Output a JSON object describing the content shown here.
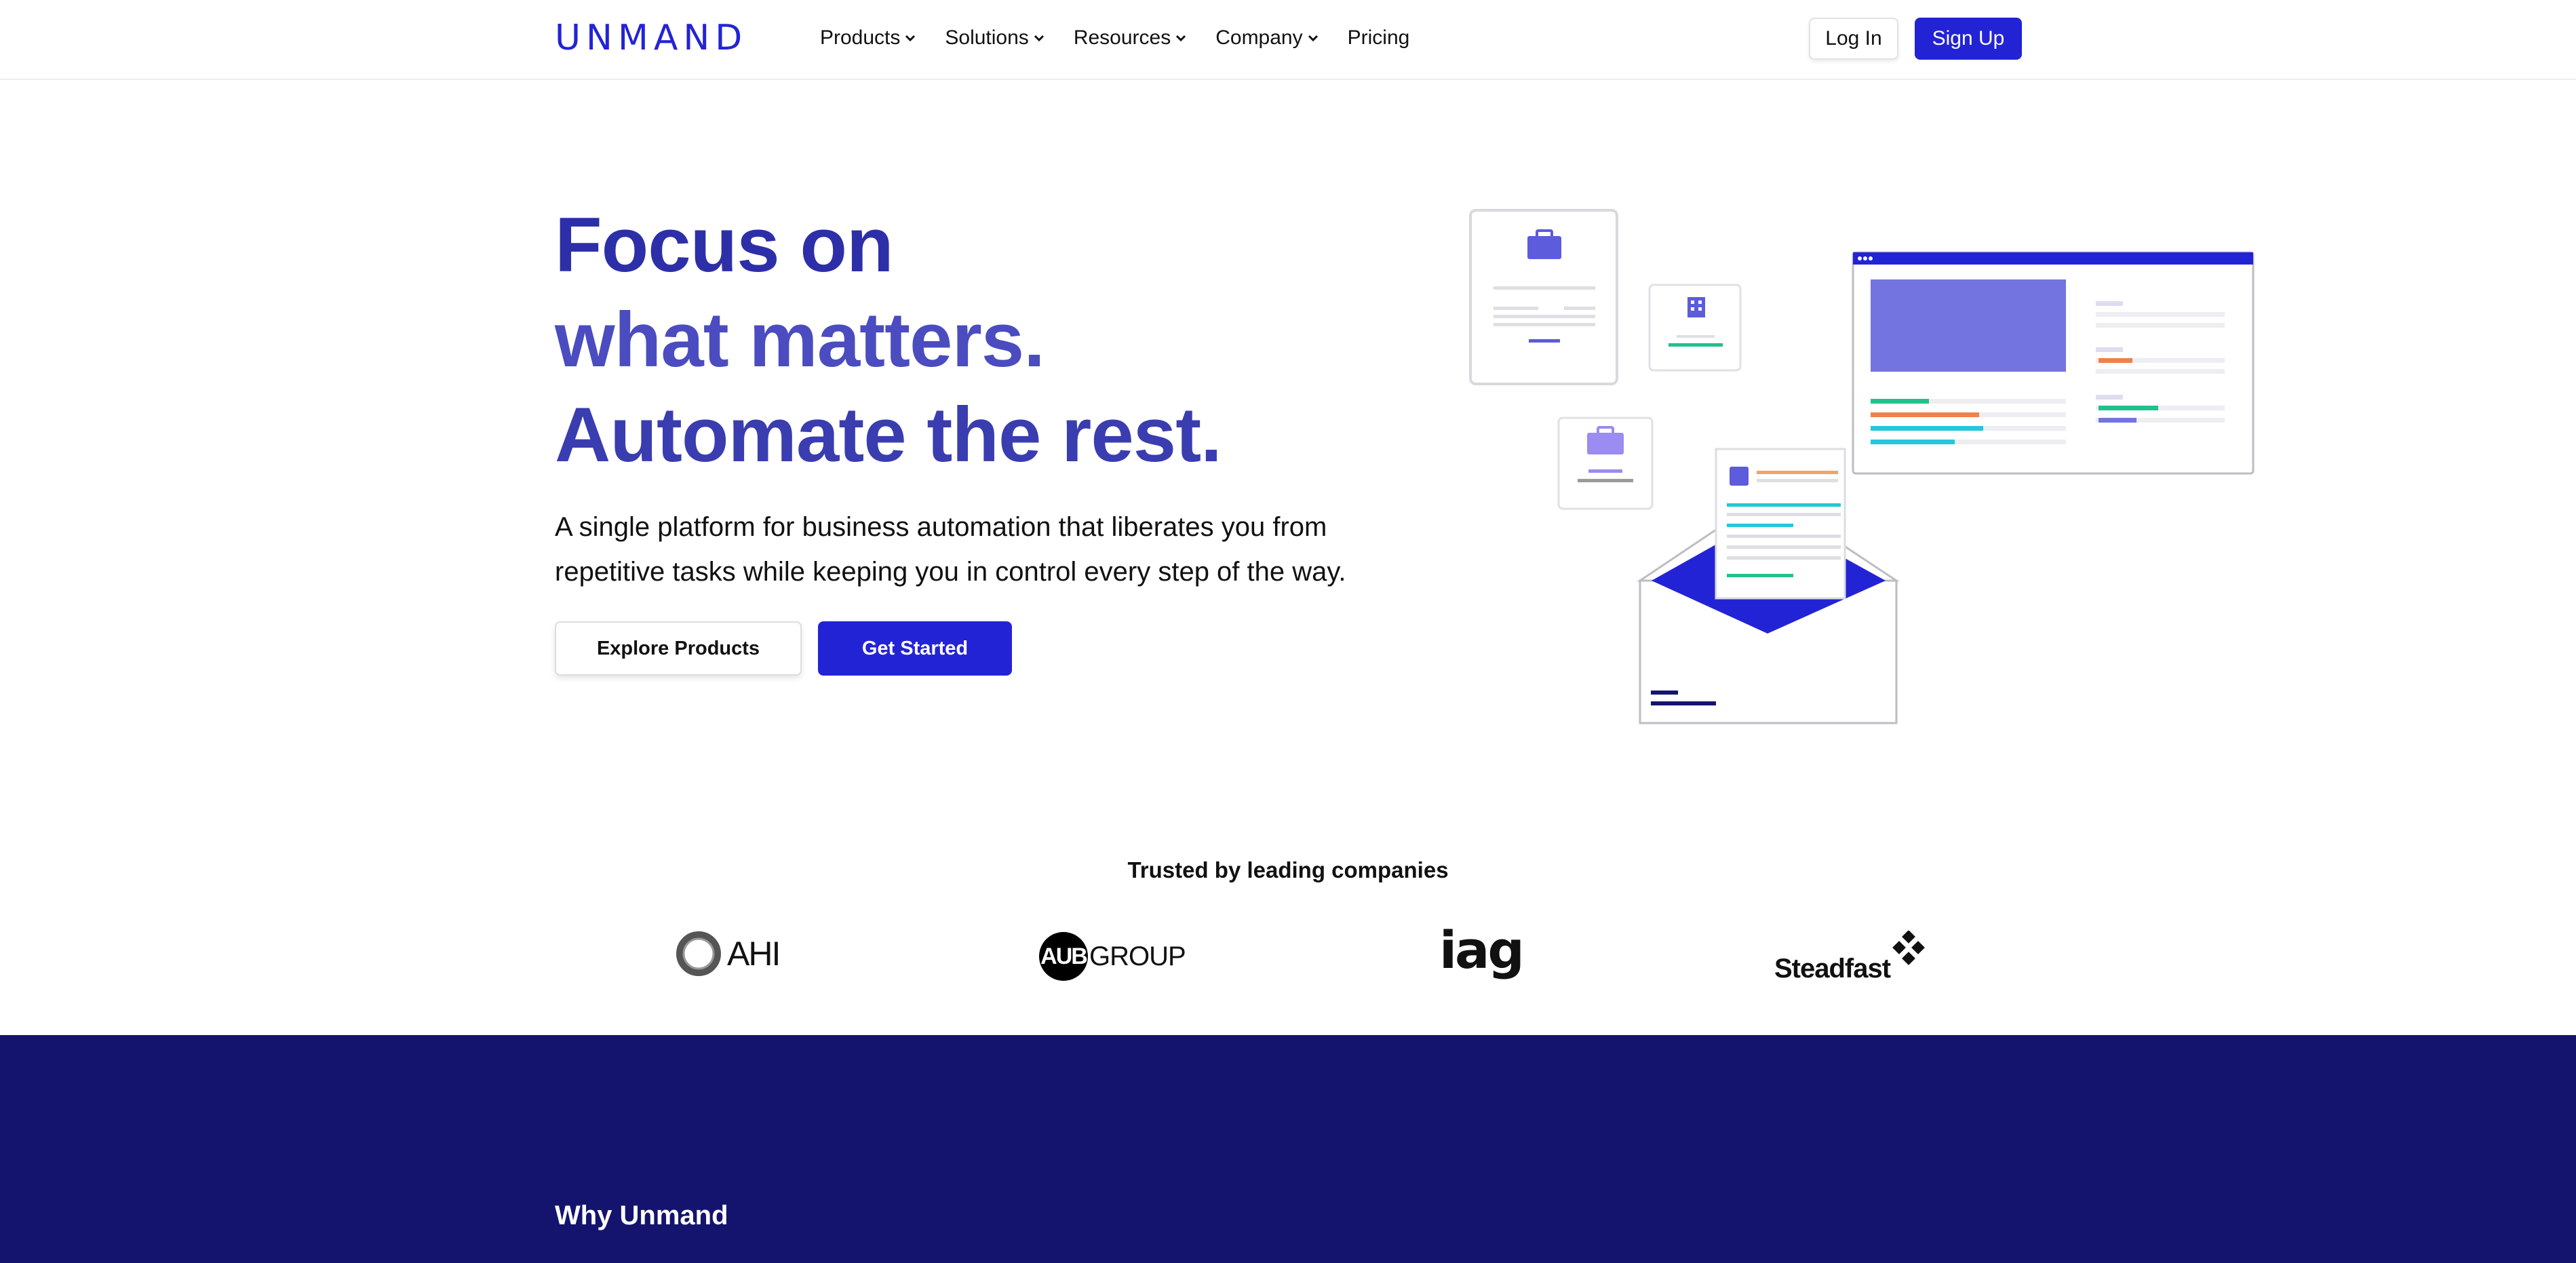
{
  "brand": {
    "logo_text": "UNMAND",
    "accent": "#2323d6",
    "dark_band": "#14146e"
  },
  "nav": {
    "items": [
      {
        "label": "Products",
        "has_dropdown": true
      },
      {
        "label": "Solutions",
        "has_dropdown": true
      },
      {
        "label": "Resources",
        "has_dropdown": true
      },
      {
        "label": "Company",
        "has_dropdown": true
      },
      {
        "label": "Pricing",
        "has_dropdown": false
      }
    ],
    "login_label": "Log In",
    "signup_label": "Sign Up"
  },
  "hero": {
    "title_lines": [
      "Focus on",
      "what matters.",
      "Automate the rest."
    ],
    "subtitle": "A single platform for business automation that liberates you from repetitive tasks while keeping you in control every step of the way.",
    "explore_label": "Explore Products",
    "started_label": "Get Started",
    "illustration_icons": [
      "briefcase-icon",
      "building-icon",
      "envelope-icon"
    ]
  },
  "trusted": {
    "title": "Trusted by leading companies",
    "logos": [
      {
        "name": "AHI",
        "text": "AHI"
      },
      {
        "name": "AUB Group",
        "mark": "AUB",
        "text": "GROUP"
      },
      {
        "name": "iag",
        "text": "iag"
      },
      {
        "name": "Steadfast",
        "text": "Steadfast"
      }
    ]
  },
  "why": {
    "title": "Why Unmand"
  }
}
